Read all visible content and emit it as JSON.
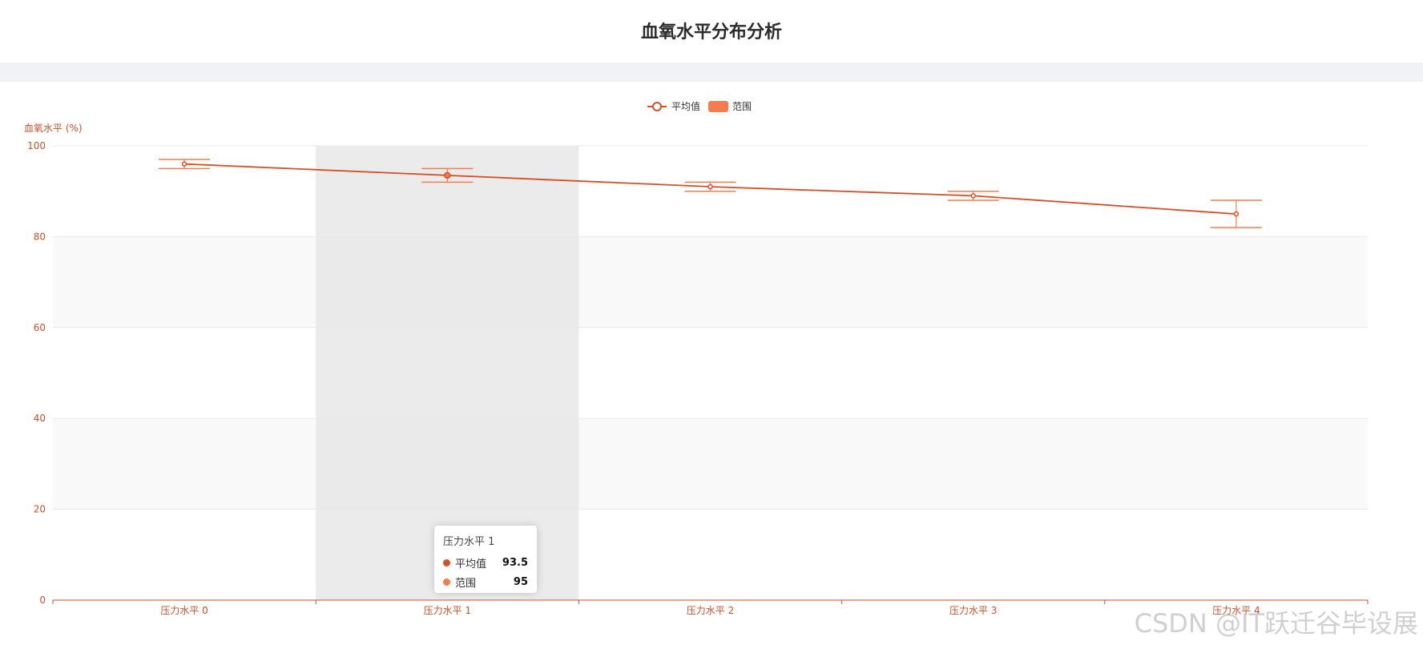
{
  "page": {
    "title": "血氧水平分布分析"
  },
  "colors": {
    "line": "#d84e27",
    "range": "#f47c4e",
    "axis": "#c6522c",
    "grid": "#e9e9e9",
    "band": "#f9f9f9",
    "hover": "#e8e8e8"
  },
  "chart_data": {
    "type": "line",
    "title": "血氧水平分布分析",
    "ylabel": "血氧水平 (%)",
    "xlabel": "",
    "categories": [
      "压力水平 0",
      "压力水平 1",
      "压力水平 2",
      "压力水平 3",
      "压力水平 4"
    ],
    "ylim": [
      0,
      100
    ],
    "yticks": [
      0,
      20,
      40,
      60,
      80,
      100
    ],
    "series": [
      {
        "name": "平均值",
        "type": "line",
        "values": [
          96,
          93.5,
          91,
          89,
          85
        ]
      },
      {
        "name": "范围",
        "type": "errorbar",
        "low": [
          95,
          92,
          90,
          88,
          82
        ],
        "high": [
          97,
          95,
          92,
          90,
          88
        ]
      }
    ],
    "legend": {
      "placement": "top-center",
      "entries": [
        "平均值",
        "范围"
      ]
    },
    "grid": true,
    "highlighted_index": 1
  },
  "tooltip": {
    "title": "压力水平 1",
    "rows": [
      {
        "label": "平均值",
        "value": "93.5"
      },
      {
        "label": "范围",
        "value": "95"
      }
    ]
  },
  "watermark": {
    "text": "CSDN @IT跃迁谷毕设展"
  }
}
